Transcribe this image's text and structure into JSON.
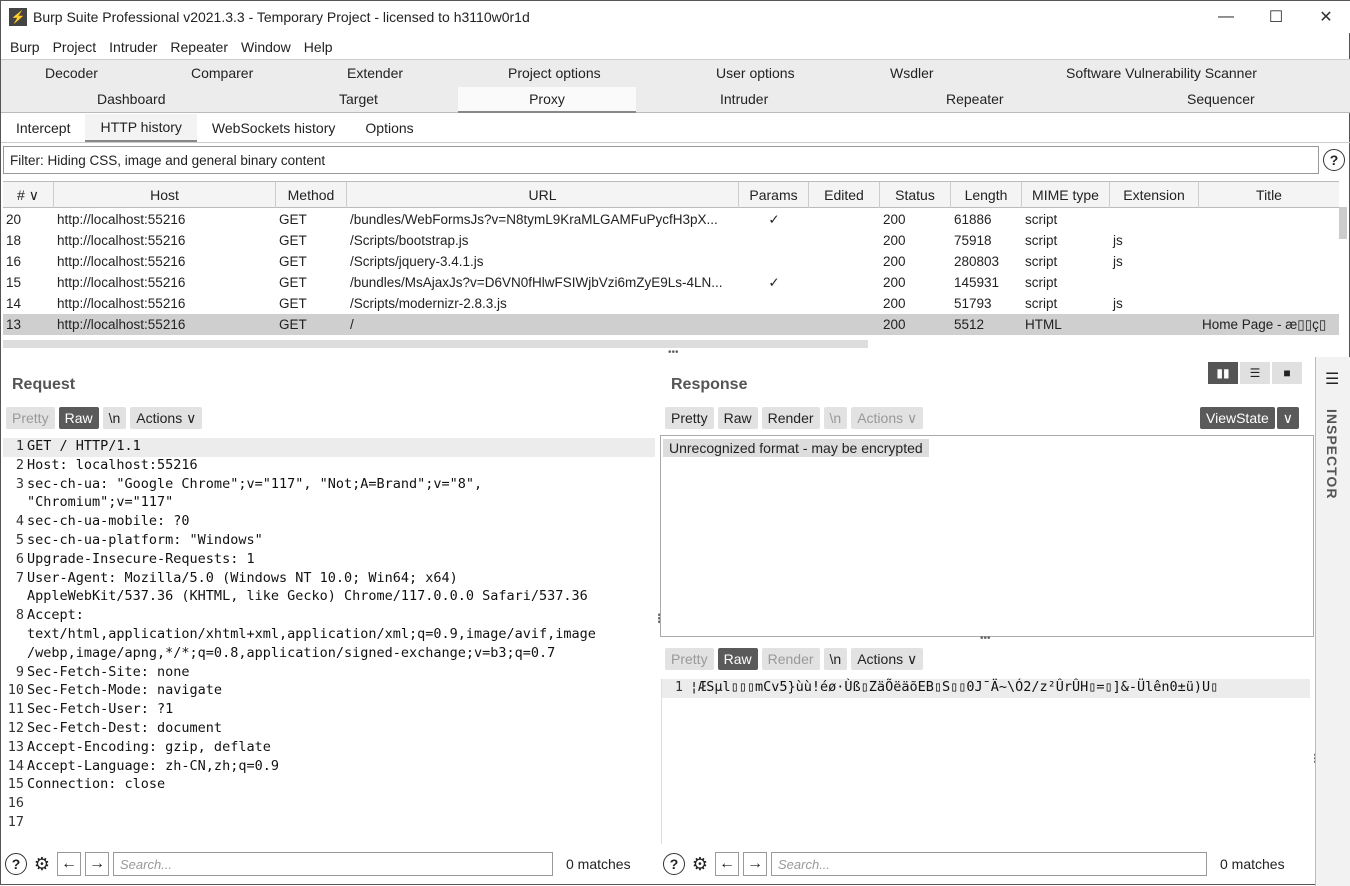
{
  "window": {
    "title": "Burp Suite Professional v2021.3.3 - Temporary Project - licensed to h3110w0r1d",
    "icon": "lightning-icon"
  },
  "menu": [
    "Burp",
    "Project",
    "Intruder",
    "Repeater",
    "Window",
    "Help"
  ],
  "top_tabs_row1": [
    "Decoder",
    "Comparer",
    "Extender",
    "Project options",
    "User options",
    "Wsdler",
    "Software Vulnerability Scanner"
  ],
  "top_tabs_row2": [
    "Dashboard",
    "Target",
    "Proxy",
    "Intruder",
    "Repeater",
    "Sequencer"
  ],
  "active_top_tab": "Proxy",
  "sub_tabs": [
    "Intercept",
    "HTTP history",
    "WebSockets history",
    "Options"
  ],
  "active_sub_tab": "HTTP history",
  "filter_text": "Filter: Hiding CSS, image and general binary content",
  "help_glyph": "?",
  "table": {
    "columns": [
      "# ∨",
      "Host",
      "Method",
      "URL",
      "Params",
      "Edited",
      "Status",
      "Length",
      "MIME type",
      "Extension",
      "Title"
    ],
    "rows": [
      {
        "num": "20",
        "host": "http://localhost:55216",
        "method": "GET",
        "url": "/bundles/WebFormsJs?v=N8tymL9KraMLGAMFuPycfH3pX...",
        "params": "✓",
        "edited": "",
        "status": "200",
        "length": "61886",
        "mime": "script",
        "ext": "",
        "title": ""
      },
      {
        "num": "18",
        "host": "http://localhost:55216",
        "method": "GET",
        "url": "/Scripts/bootstrap.js",
        "params": "",
        "edited": "",
        "status": "200",
        "length": "75918",
        "mime": "script",
        "ext": "js",
        "title": ""
      },
      {
        "num": "16",
        "host": "http://localhost:55216",
        "method": "GET",
        "url": "/Scripts/jquery-3.4.1.js",
        "params": "",
        "edited": "",
        "status": "200",
        "length": "280803",
        "mime": "script",
        "ext": "js",
        "title": ""
      },
      {
        "num": "15",
        "host": "http://localhost:55216",
        "method": "GET",
        "url": "/bundles/MsAjaxJs?v=D6VN0fHlwFSIWjbVzi6mZyE9Ls-4LN...",
        "params": "✓",
        "edited": "",
        "status": "200",
        "length": "145931",
        "mime": "script",
        "ext": "",
        "title": ""
      },
      {
        "num": "14",
        "host": "http://localhost:55216",
        "method": "GET",
        "url": "/Scripts/modernizr-2.8.3.js",
        "params": "",
        "edited": "",
        "status": "200",
        "length": "51793",
        "mime": "script",
        "ext": "js",
        "title": ""
      },
      {
        "num": "13",
        "host": "http://localhost:55216",
        "method": "GET",
        "url": "/",
        "params": "",
        "edited": "",
        "status": "200",
        "length": "5512",
        "mime": "HTML",
        "ext": "",
        "title": "Home Page - æ▯▯ç▯"
      }
    ],
    "selected_row": 5
  },
  "request": {
    "title": "Request",
    "buttons": [
      "Pretty",
      "Raw",
      "\\n",
      "Actions ∨"
    ],
    "lines": [
      {
        "n": "1",
        "t": "GET / HTTP/1.1"
      },
      {
        "n": "2",
        "t": "Host: localhost:55216"
      },
      {
        "n": "3",
        "t": "sec-ch-ua: \"Google Chrome\";v=\"117\", \"Not;A=Brand\";v=\"8\","
      },
      {
        "n": "",
        "t": "\"Chromium\";v=\"117\""
      },
      {
        "n": "4",
        "t": "sec-ch-ua-mobile: ?0"
      },
      {
        "n": "5",
        "t": "sec-ch-ua-platform: \"Windows\""
      },
      {
        "n": "6",
        "t": "Upgrade-Insecure-Requests: 1"
      },
      {
        "n": "7",
        "t": "User-Agent: Mozilla/5.0 (Windows NT 10.0; Win64; x64)"
      },
      {
        "n": "",
        "t": "AppleWebKit/537.36 (KHTML, like Gecko) Chrome/117.0.0.0 Safari/537.36"
      },
      {
        "n": "8",
        "t": "Accept:"
      },
      {
        "n": "",
        "t": "text/html,application/xhtml+xml,application/xml;q=0.9,image/avif,image"
      },
      {
        "n": "",
        "t": "/webp,image/apng,*/*;q=0.8,application/signed-exchange;v=b3;q=0.7"
      },
      {
        "n": "9",
        "t": "Sec-Fetch-Site: none"
      },
      {
        "n": "10",
        "t": "Sec-Fetch-Mode: navigate"
      },
      {
        "n": "11",
        "t": "Sec-Fetch-User: ?1"
      },
      {
        "n": "12",
        "t": "Sec-Fetch-Dest: document"
      },
      {
        "n": "13",
        "t": "Accept-Encoding: gzip, deflate"
      },
      {
        "n": "14",
        "t": "Accept-Language: zh-CN,zh;q=0.9"
      },
      {
        "n": "15",
        "t": "Connection: close"
      },
      {
        "n": "16",
        "t": ""
      },
      {
        "n": "17",
        "t": ""
      }
    ],
    "search_placeholder": "Search...",
    "matches": "0 matches"
  },
  "response": {
    "title": "Response",
    "buttons_top": [
      "Pretty",
      "Raw",
      "Render",
      "\\n",
      "Actions ∨"
    ],
    "viewstate_label": "ViewState",
    "viewstate_dropdown": "∨",
    "notice": "Unrecognized format - may be encrypted",
    "buttons_bottom": [
      "Pretty",
      "Raw",
      "Render",
      "\\n",
      "Actions ∨"
    ],
    "line_num": "1",
    "encoded_line": "¦ÆSµl▯▯▯mCv5}ùù!éø·Ùß▯ZäÕëäõEB▯S▯▯0J¯Ä~\\Ó2/z²ÛrÛH▯=▯]&-Ülên0±ü)U▯",
    "search_placeholder": "Search...",
    "matches": "0 matches"
  },
  "inspector_label": "INSPECTOR"
}
